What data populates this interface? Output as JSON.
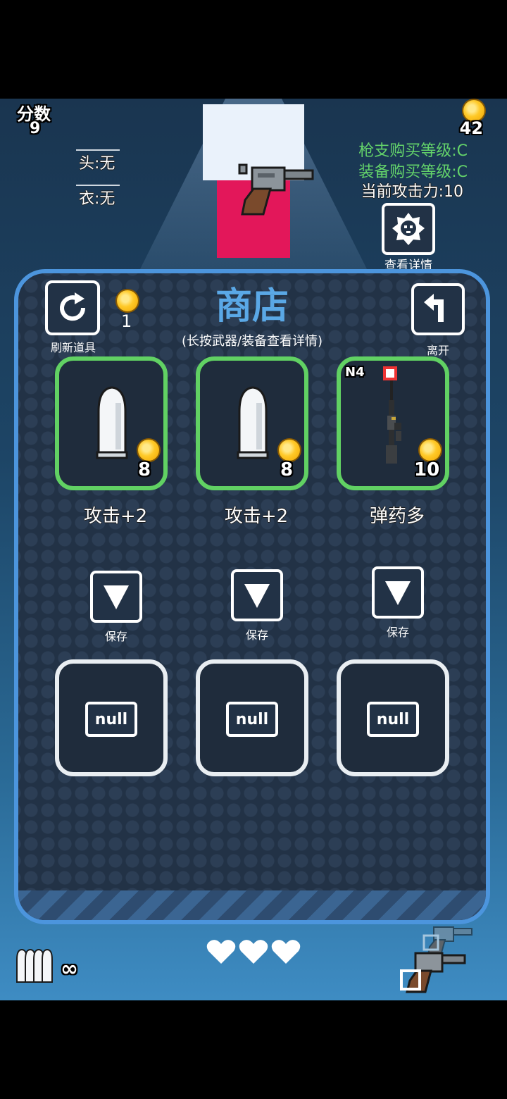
{
  "hud": {
    "score_label": "分数",
    "score_value": "9",
    "head_equip": "头:无",
    "body_equip": "衣:无",
    "coins": "42",
    "gun_level": "枪支购买等级:C",
    "equip_level": "装备购买等级:C",
    "attack_power": "当前攻击力:10",
    "details_label": "查看详情",
    "ammo": "∞",
    "hearts": 3
  },
  "shop": {
    "title": "商店",
    "subtitle": "(长按武器/装备查看详情)",
    "refresh_label": "刷新道具",
    "refresh_cost": "1",
    "leave_label": "离开",
    "items": [
      {
        "kind": "bullet",
        "price": "8",
        "desc": "攻击+2",
        "tag": ""
      },
      {
        "kind": "bullet",
        "price": "8",
        "desc": "攻击+2",
        "tag": ""
      },
      {
        "kind": "rifle",
        "price": "10",
        "desc": "弹药多",
        "tag": "N4"
      }
    ],
    "save_label": "保存",
    "slots": [
      "null",
      "null",
      "null"
    ]
  },
  "colors": {
    "accent_green": "#61d163",
    "panel_border": "#4c95dd",
    "gun_level_text": "#63d26a",
    "pink": "#e3175a"
  }
}
